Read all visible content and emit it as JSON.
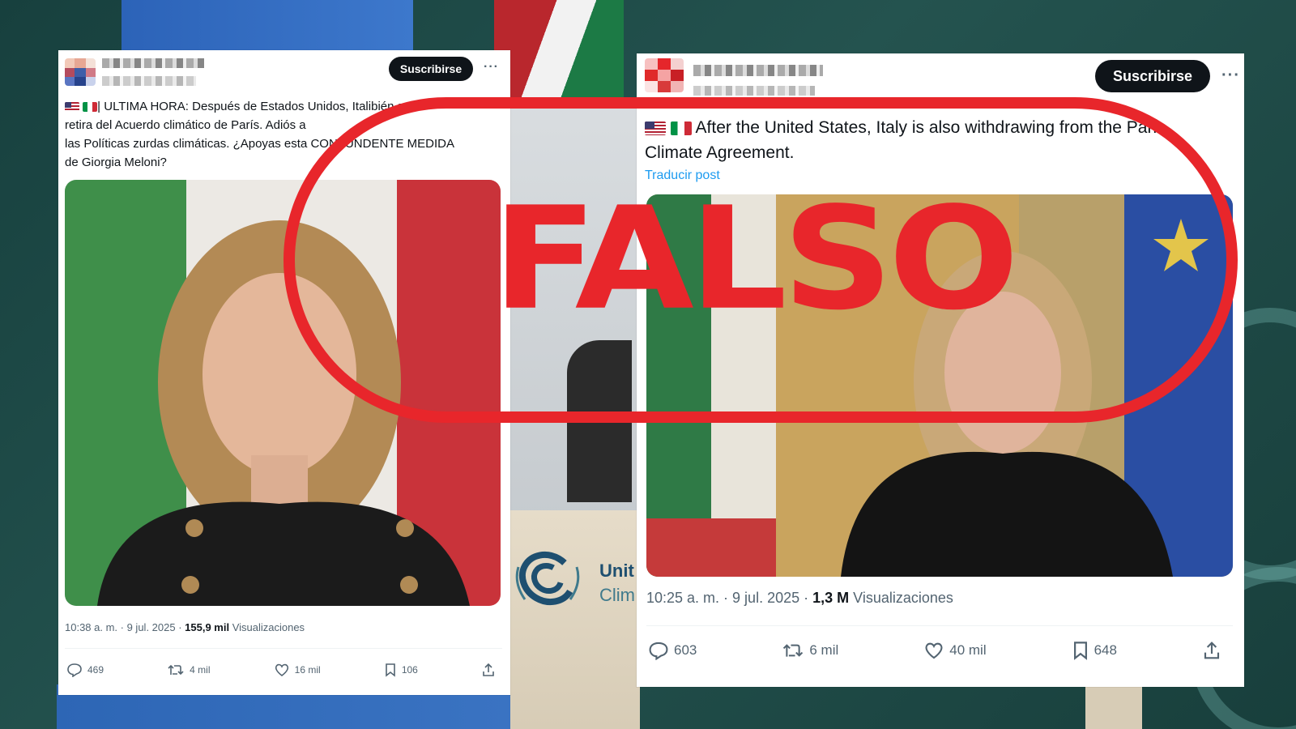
{
  "colors": {
    "stamp": "#e8262b",
    "subscribe_bg": "#0f1419",
    "translate_link": "#1d9bf0",
    "meta_text": "#536471"
  },
  "stamp": {
    "label": "FALSO"
  },
  "background": {
    "logo_line1": "Unit",
    "logo_line2": "Clim"
  },
  "left_post": {
    "subscribe_label": "Suscribirse",
    "more_icon": "more-horizontal-icon",
    "text_line1": "| ULTIMA HORA: Después de Estados Unidos, Itali",
    "text_line1_tail": "bién se",
    "text_line2": "retira del Acuerdo climático de París. Adiós a",
    "text_line3": "las Políticas zurdas climáticas. ¿Apoyas esta CONTUNDENTE MEDIDA",
    "text_line4": "de Giorgia Meloni?",
    "time": "10:38 a. m. · 9 jul. 2025 · ",
    "views_count": "155,9 mil",
    "views_label": " Visualizaciones",
    "replies": "469",
    "reposts": "4 mil",
    "likes": "16 mil",
    "bookmarks": "106"
  },
  "right_post": {
    "subscribe_label": "Suscribirse",
    "more_icon": "more-horizontal-icon",
    "text_line1": "After the United States, Italy is also withdrawing from the Paris",
    "text_line2": "Climate Agreement.",
    "translate_label": "Traducir post",
    "time": "10:25 a. m. · 9 jul. 2025 · ",
    "views_count": "1,3 M",
    "views_label": " Visualizaciones",
    "replies": "603",
    "reposts": "6 mil",
    "likes": "40 mil",
    "bookmarks": "648"
  }
}
